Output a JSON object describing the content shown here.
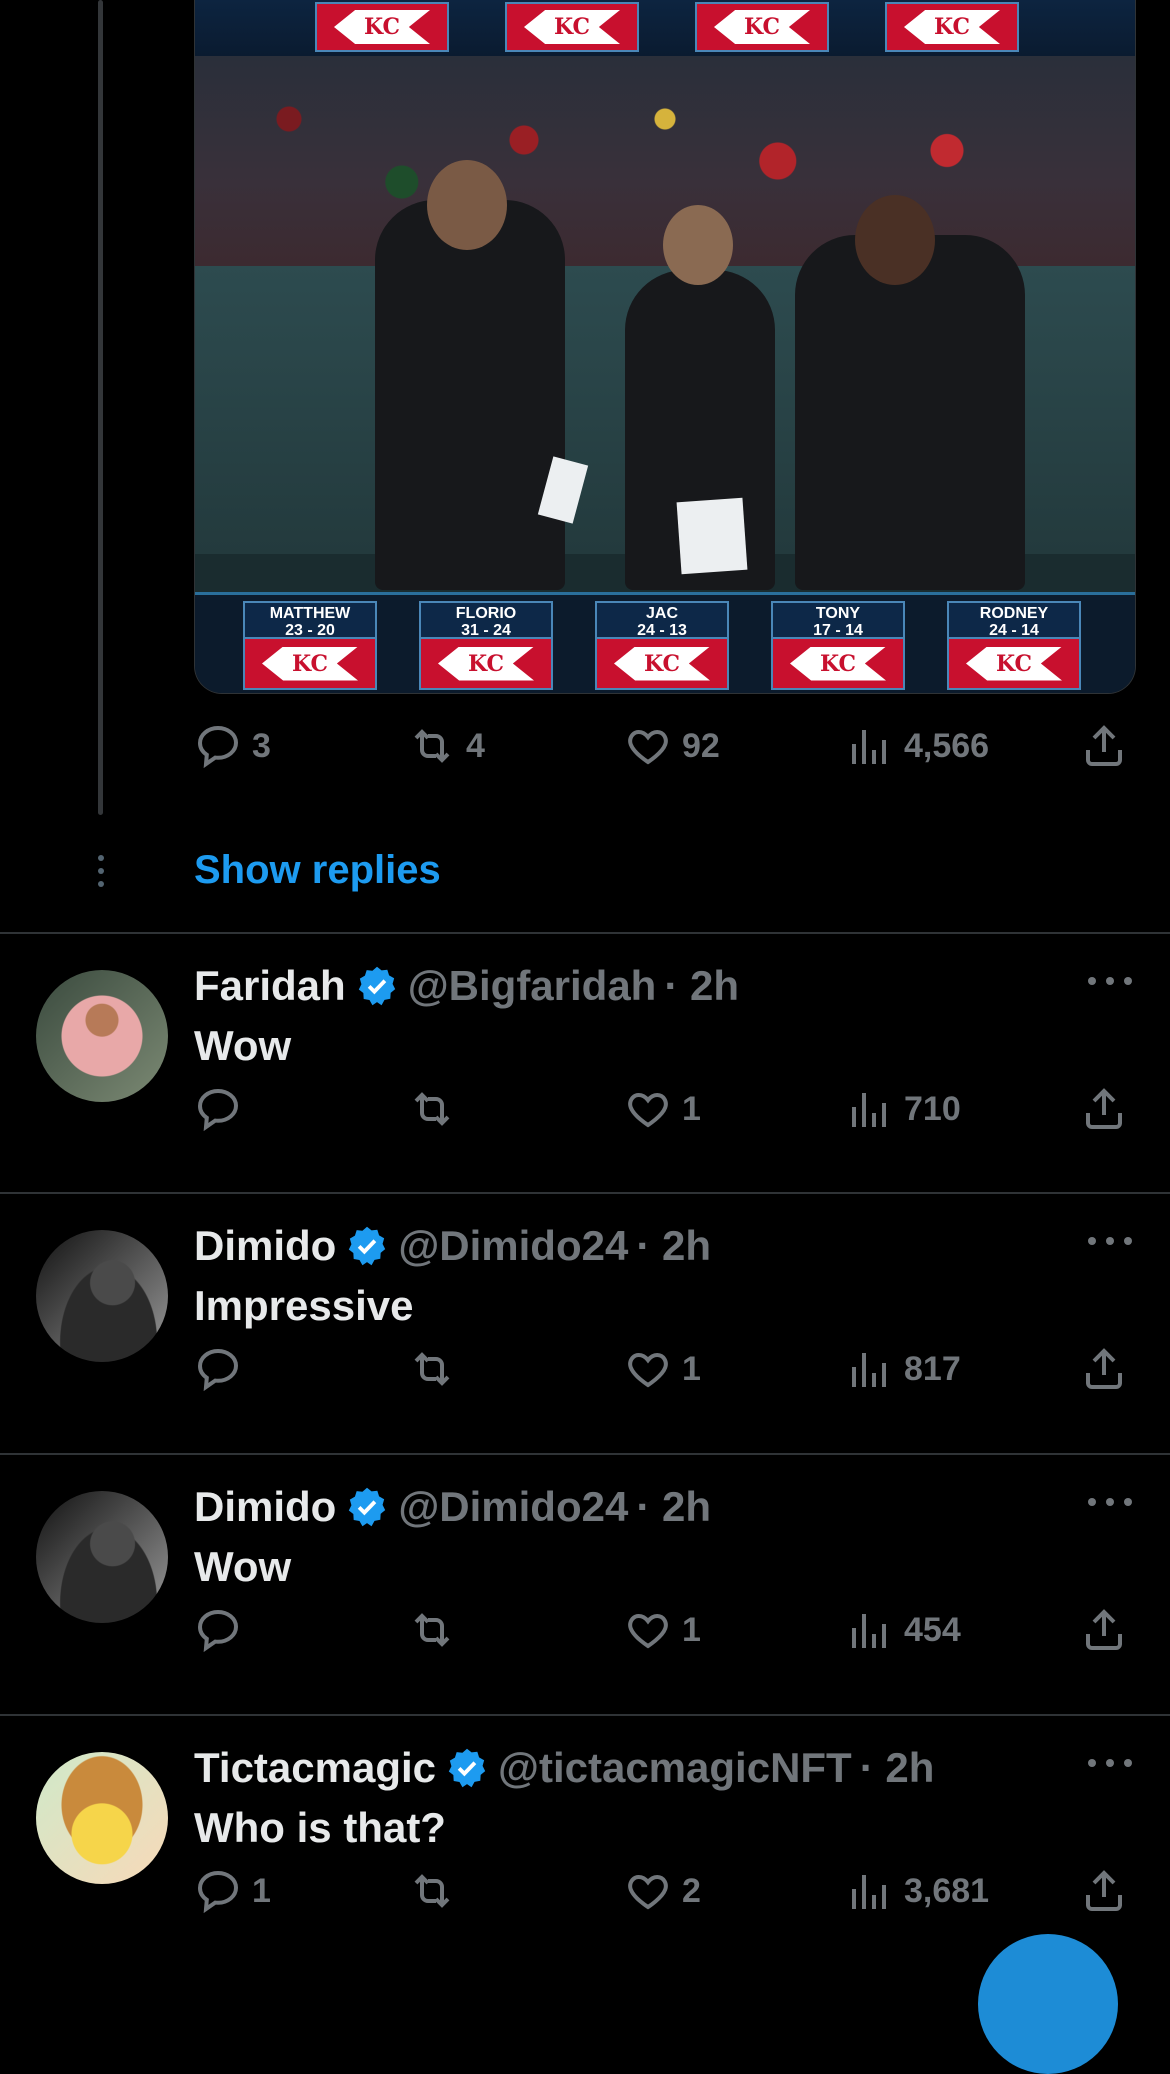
{
  "main_tweet": {
    "media": {
      "picks": [
        {
          "name": "MATTHEW",
          "score": "23 - 20"
        },
        {
          "name": "FLORIO",
          "score": "31 - 24"
        },
        {
          "name": "JAC",
          "score": "24 - 13"
        },
        {
          "name": "TONY",
          "score": "17 - 14"
        },
        {
          "name": "RODNEY",
          "score": "24 - 14"
        }
      ],
      "logo_text": "KC"
    },
    "stats": {
      "replies": "3",
      "reposts": "4",
      "likes": "92",
      "views": "4,566"
    }
  },
  "show_replies_label": "Show replies",
  "colors": {
    "accent": "#1d9bf0",
    "muted": "#71767b",
    "background": "#000000"
  },
  "icons": [
    "reply-icon",
    "repost-icon",
    "like-icon",
    "views-icon",
    "share-icon",
    "verified-icon",
    "more-icon"
  ],
  "replies": [
    {
      "name": "Faridah",
      "handle": "@Bigfaridah",
      "time": "· 2h",
      "text": "Wow",
      "stats": {
        "replies": "",
        "reposts": "",
        "likes": "1",
        "views": "710"
      }
    },
    {
      "name": "Dimido",
      "handle": "@Dimido24",
      "time": "· 2h",
      "text": "Impressive",
      "stats": {
        "replies": "",
        "reposts": "",
        "likes": "1",
        "views": "817"
      }
    },
    {
      "name": "Dimido",
      "handle": "@Dimido24",
      "time": "· 2h",
      "text": "Wow",
      "stats": {
        "replies": "",
        "reposts": "",
        "likes": "1",
        "views": "454"
      }
    },
    {
      "name": "Tictacmagic",
      "handle": "@tictacmagicNFT",
      "time": "· 2h",
      "text": "Who is that?",
      "stats": {
        "replies": "1",
        "reposts": "",
        "likes": "2",
        "views": "3,681"
      }
    }
  ]
}
